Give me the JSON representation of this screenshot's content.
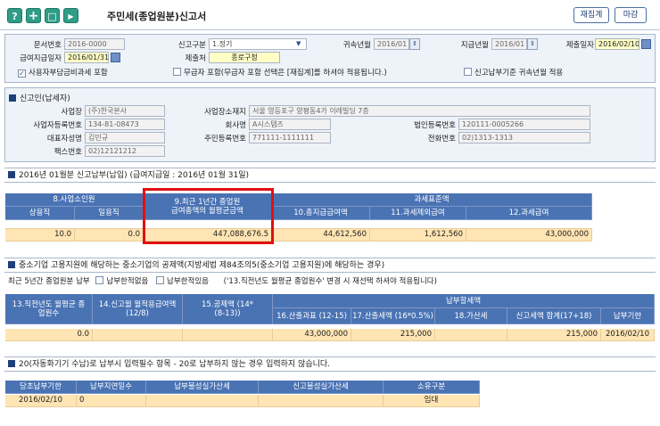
{
  "window": {
    "title": "주민세(종업원분)신고서",
    "recalc_label": "재집계",
    "close_label": "마감",
    "toolbar": [
      "?",
      "+",
      "□",
      "▶"
    ]
  },
  "header": {
    "doc_no_label": "문서번호",
    "doc_no": "2016-0000",
    "report_type_label": "신고구분",
    "report_type": "1.정기",
    "belong_label": "귀속년월",
    "belong": "2016/01",
    "pay_month_label": "지급년월",
    "pay_month": "2016/01",
    "submit_date_label": "제출일자",
    "submit_date": "2016/02/10",
    "pay_date_label": "급여지급일자",
    "pay_date": "2016/01/31",
    "submitter_label": "제출처",
    "submitter": "종로구청",
    "chk1": "사용자부담금비과세 포함",
    "chk2": "무급자 포함(무급자 포함 선택은 [재집계]를 하셔야 적용됩니다.)",
    "chk3": "신고납부기준 귀속년월 적용"
  },
  "reporter": {
    "section_title": "신고인(납세자)",
    "biz_name_label": "사업장",
    "biz_name": "(주)한국본사",
    "biz_addr_label": "사업장소재지",
    "biz_addr": "서울 영등포구 양평동4가 이레빌딩 7층",
    "biz_reg_label": "사업자등록번호",
    "biz_reg": "134-81-08473",
    "company_label": "회사명",
    "company": "A시스템즈",
    "corp_reg_label": "법인등록번호",
    "corp_reg": "120111-0005266",
    "ceo_label": "대표자성명",
    "ceo": "김민규",
    "resident_label": "주민등록번호",
    "resident": "771111-1111111",
    "phone_label": "전화번호",
    "phone": "02)1313-1313",
    "fax_label": "팩스번호",
    "fax": "02)12121212"
  },
  "sec2": {
    "title": "2016년 01월분 신고납부(납입) (급여지급일 : 2016년 01월 31일)",
    "h_emp": "8.사업소인원",
    "h_avg": "9.최근 1년간 종업원 급여총액의 월평균금액",
    "h_std": "과세표준액",
    "h_regular": "상용직",
    "h_daily": "일용직",
    "h_total": "10.총지급급여액",
    "h_exempt": "11.과세제외급여",
    "h_taxable": "12.과세급여",
    "regular": "10.0",
    "daily": "0.0",
    "avg": "447,088,676.5",
    "total": "44,612,560",
    "exempt": "1,612,560",
    "taxable": "43,000,000"
  },
  "sec3": {
    "title": "중소기업 고용지원에 해당하는 중소기업의 공제액(지방세법 제84조의5(중소기업 고용지원)에 해당하는 경우)",
    "sub_label": "최근 5년간 종업원분 납부",
    "opt1": "납부한적없음",
    "opt2": "납부한적있음",
    "note": "('13.직전년도 월평균 종업원수' 변경 시 재선택 하셔야 적용됩니다)",
    "h13": "13.직전년도 월평균 종업원수",
    "h14": "14.신고월 월적용급여액 (12/8)",
    "h15": "15.공제액 (14*(8-13))",
    "h_tax": "납부할세액",
    "h16": "16.산출과표 (12-15)",
    "h17": "17.산출세액 (16*0.5%)",
    "h18": "18.가산세",
    "h_sum": "신고세액 합계(17+18)",
    "h_due": "납부기한",
    "v13": "0.0",
    "v16": "43,000,000",
    "v17": "215,000",
    "v_sum": "215,000",
    "v_due": "2016/02/10"
  },
  "sec4": {
    "title": "20(자동화기기 수납)로 납부시 입력필수 항목 - 20로 납부하지 않는 경우 입력하지 않습니다.",
    "h1": "당초납부기한",
    "h2": "납부지연일수",
    "h3": "납부불성실가산세",
    "h4": "신고불성실가산세",
    "h5": "소유구분",
    "v1": "2016/02/10",
    "v2": "0",
    "v5": "임대"
  }
}
